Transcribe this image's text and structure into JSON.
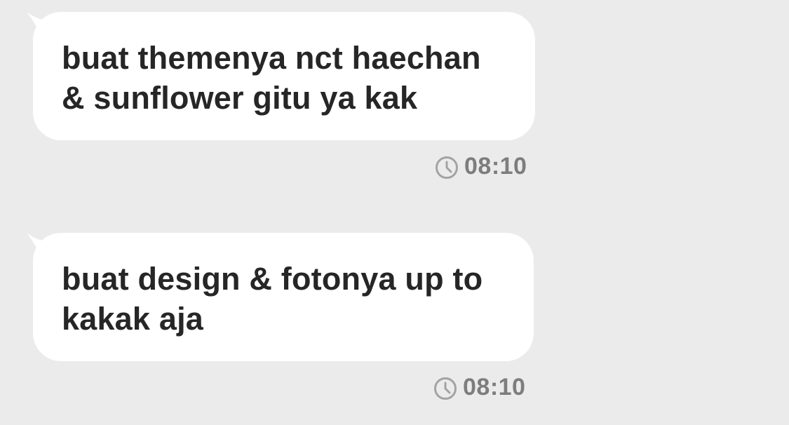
{
  "messages": [
    {
      "text": "buat themenya nct haechan\n& sunflower gitu ya kak",
      "time": "08:10",
      "status_icon": "clock-icon"
    },
    {
      "text": "buat design & fotonya up to\nkakak aja",
      "time": "08:10",
      "status_icon": "clock-icon"
    }
  ],
  "colors": {
    "background": "#ebebeb",
    "bubble": "#ffffff",
    "text": "#262626",
    "time": "#7d7d7d"
  }
}
